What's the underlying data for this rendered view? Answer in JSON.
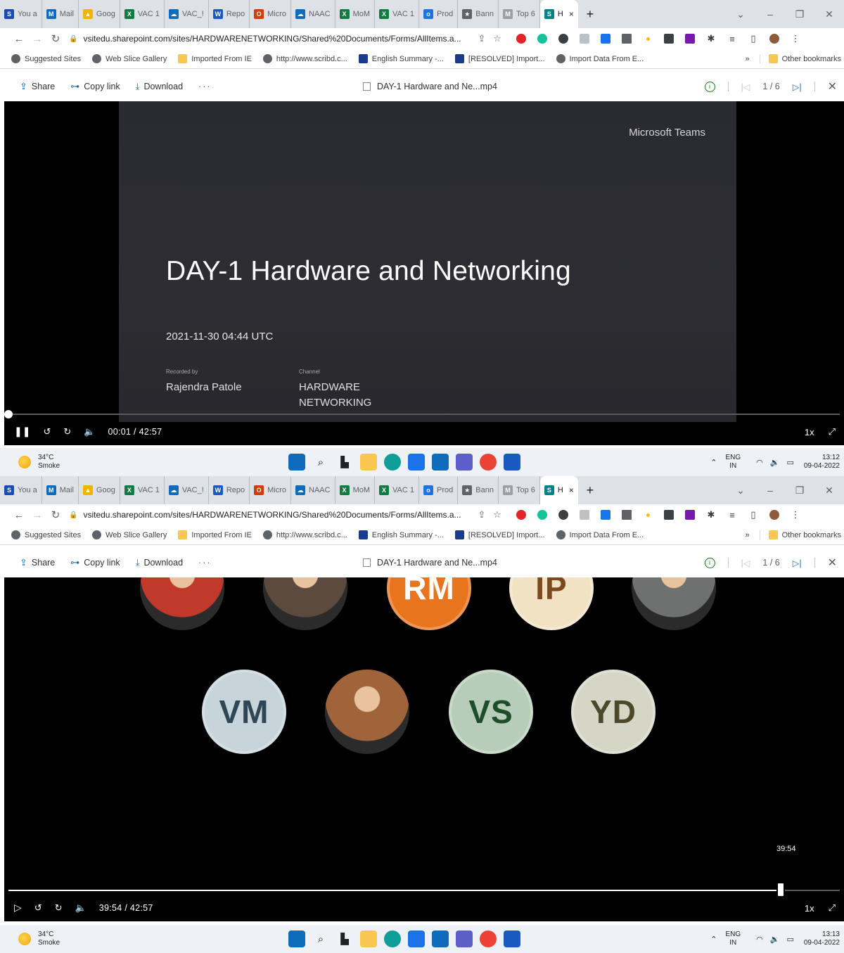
{
  "browser": {
    "tabs": [
      {
        "label": "You a",
        "icon_color": "#1a4db3",
        "icon_char": "S"
      },
      {
        "label": "Mail",
        "icon_color": "#0f6cbd",
        "icon_char": "M"
      },
      {
        "label": "Goog",
        "icon_color": "#f4b400",
        "icon_char": "▲"
      },
      {
        "label": "VAC 1",
        "icon_color": "#107c41",
        "icon_char": "X"
      },
      {
        "label": "VAC_!",
        "icon_color": "#0f6cbd",
        "icon_char": "☁"
      },
      {
        "label": "Repo",
        "icon_color": "#185abd",
        "icon_char": "W"
      },
      {
        "label": "Micro",
        "icon_color": "#d83b01",
        "icon_char": "O"
      },
      {
        "label": "NAAC",
        "icon_color": "#0f6cbd",
        "icon_char": "☁"
      },
      {
        "label": "MoM",
        "icon_color": "#107c41",
        "icon_char": "X"
      },
      {
        "label": "VAC 1",
        "icon_color": "#107c41",
        "icon_char": "X"
      },
      {
        "label": "Prod",
        "icon_color": "#1a73e8",
        "icon_char": "o"
      },
      {
        "label": "Bann",
        "icon_color": "#5f6368",
        "icon_char": "★"
      },
      {
        "label": "Top 6",
        "icon_color": "#9aa0a6",
        "icon_char": "M"
      }
    ],
    "active_tab": {
      "label": "H",
      "close": "×",
      "icon_color": "#038387"
    },
    "new_tab": "+",
    "window_controls": [
      "⌄",
      "–",
      "❐",
      "✕"
    ],
    "url": "vsitedu.sharepoint.com/sites/HARDWARENETWORKING/Shared%20Documents/Forms/AllItems.a...",
    "bookmarks": [
      {
        "label": "Suggested Sites",
        "icon": "globe-icon"
      },
      {
        "label": "Web Slice Gallery",
        "icon": "globe-icon"
      },
      {
        "label": "Imported From IE",
        "icon": "folder-icon"
      },
      {
        "label": "http://www.scribd.c...",
        "icon": "scribd-icon"
      },
      {
        "label": "English Summary -...",
        "icon": "e-icon"
      },
      {
        "label": "[RESOLVED] Import...",
        "icon": "ve-icon"
      },
      {
        "label": "Import Data From E...",
        "icon": "globe-icon"
      }
    ],
    "bookmarks_overflow": "»",
    "other_bookmarks": "Other bookmarks"
  },
  "viewer": {
    "share": "Share",
    "copy_link": "Copy link",
    "download": "Download",
    "more": "···",
    "file_title": "DAY-1 Hardware and Ne...mp4",
    "page": "1 / 6"
  },
  "slide": {
    "brand": "Microsoft Teams",
    "title": "DAY-1 Hardware and Networking",
    "date": "2021-11-30 04:44 UTC",
    "recorded_by_label": "Recorded by",
    "recorded_by": "Rajendra Patole",
    "channel_label": "Channel",
    "channel_line1": "HARDWARE",
    "channel_line2": "NETWORKING"
  },
  "player1": {
    "time": "00:01 / 42:57",
    "speed": "1x",
    "progress": 0.0004
  },
  "player2": {
    "time": "39:54 / 42:57",
    "speed": "1x",
    "progress": 0.929,
    "hover_time": "39:54"
  },
  "participants": [
    {
      "type": "photo",
      "bg": "#c0392b"
    },
    {
      "type": "photo",
      "bg": "#5b4a3d"
    },
    {
      "type": "initials",
      "initials": "RM",
      "bg": "#e8741d",
      "fg": "#ffffff"
    },
    {
      "type": "initials",
      "initials": "IP",
      "bg": "#f2e2c4",
      "fg": "#7a4a1e"
    },
    {
      "type": "photo",
      "bg": "#6f7070"
    },
    {
      "type": "initials",
      "initials": "VM",
      "bg": "#c7d4da",
      "fg": "#2e4656"
    },
    {
      "type": "photo",
      "bg": "#a0633a"
    },
    {
      "type": "initials",
      "initials": "VS",
      "bg": "#b7cdb9",
      "fg": "#1f4d2a"
    },
    {
      "type": "initials",
      "initials": "YD",
      "bg": "#d5d6c6",
      "fg": "#4a4a2a"
    }
  ],
  "taskbar": {
    "temp": "34°C",
    "weather": "Smoke",
    "lang1": "ENG",
    "lang2": "IN",
    "date": "09-04-2022",
    "time1": "13:12",
    "time2": "13:13"
  }
}
